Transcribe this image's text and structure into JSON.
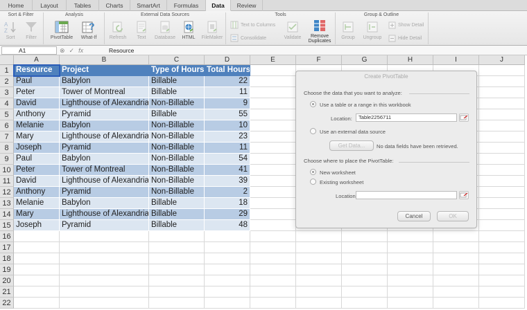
{
  "ribbon": {
    "tabs": [
      "Home",
      "Layout",
      "Tables",
      "Charts",
      "SmartArt",
      "Formulas",
      "Data",
      "Review"
    ],
    "active_tab": "Data",
    "groups": {
      "sort_filter": "Sort & Filter",
      "analysis": "Analysis",
      "external": "External Data Sources",
      "tools": "Tools",
      "group_outline": "Group & Outline"
    },
    "buttons": {
      "sort": "Sort",
      "filter": "Filter",
      "pivottable": "PivotTable",
      "whatif": "What-If",
      "refresh": "Refresh",
      "text": "Text",
      "database": "Database",
      "html": "HTML",
      "filemaker": "FileMaker",
      "text_to_columns": "Text to Columns",
      "consolidate": "Consolidate",
      "validate": "Validate",
      "remove_duplicates_1": "Remove",
      "remove_duplicates_2": "Duplicates",
      "group": "Group",
      "ungroup": "Ungroup",
      "show_detail": "Show Detail",
      "hide_detail": "Hide Detail"
    }
  },
  "formula_bar": {
    "name_box": "A1",
    "fx": "fx",
    "value": "Resource"
  },
  "sheet": {
    "columns": [
      "A",
      "B",
      "C",
      "D",
      "E",
      "F",
      "G",
      "H",
      "I",
      "J"
    ],
    "rows": [
      "1",
      "2",
      "3",
      "4",
      "5",
      "6",
      "7",
      "8",
      "9",
      "10",
      "11",
      "12",
      "13",
      "14",
      "15",
      "16",
      "17",
      "18",
      "19",
      "20",
      "21",
      "22"
    ],
    "headers": [
      "Resource",
      "Project",
      "Type of Hours",
      "Total Hours"
    ],
    "data": [
      [
        "Paul",
        "Babylon",
        "Billable",
        "22"
      ],
      [
        "Peter",
        "Tower of Montreal",
        "Billable",
        "11"
      ],
      [
        "David",
        "Lighthouse of Alexandria",
        "Non-Billable",
        "9"
      ],
      [
        "Anthony",
        "Pyramid",
        "Billable",
        "55"
      ],
      [
        "Melanie",
        "Babylon",
        "Non-Billable",
        "10"
      ],
      [
        "Mary",
        "Lighthouse of Alexandria",
        "Non-Billable",
        "23"
      ],
      [
        "Joseph",
        "Pyramid",
        "Non-Billable",
        "11"
      ],
      [
        "Paul",
        "Babylon",
        "Non-Billable",
        "54"
      ],
      [
        "Peter",
        "Tower of Montreal",
        "Non-Billable",
        "41"
      ],
      [
        "David",
        "Lighthouse of Alexandria",
        "Non-Billable",
        "39"
      ],
      [
        "Anthony",
        "Pyramid",
        "Non-Billable",
        "2"
      ],
      [
        "Melanie",
        "Babylon",
        "Billable",
        "18"
      ],
      [
        "Mary",
        "Lighthouse of Alexandria",
        "Billable",
        "29"
      ],
      [
        "Joseph",
        "Pyramid",
        "Billable",
        "48"
      ]
    ]
  },
  "dialog": {
    "title": "Create PivotTable",
    "choose_data": "Choose the data that you want to analyze:",
    "use_table": "Use a table or a range in this workbook",
    "location_label": "Location:",
    "location_value": "Table2256711",
    "use_external": "Use an external data source",
    "get_data": "Get Data...",
    "no_data_fields": "No data fields have been retrieved.",
    "choose_place": "Choose where to place the PivotTable:",
    "new_worksheet": "New worksheet",
    "existing_worksheet": "Existing worksheet",
    "location2_label": "Location:",
    "location2_value": "",
    "cancel": "Cancel",
    "ok": "OK"
  }
}
